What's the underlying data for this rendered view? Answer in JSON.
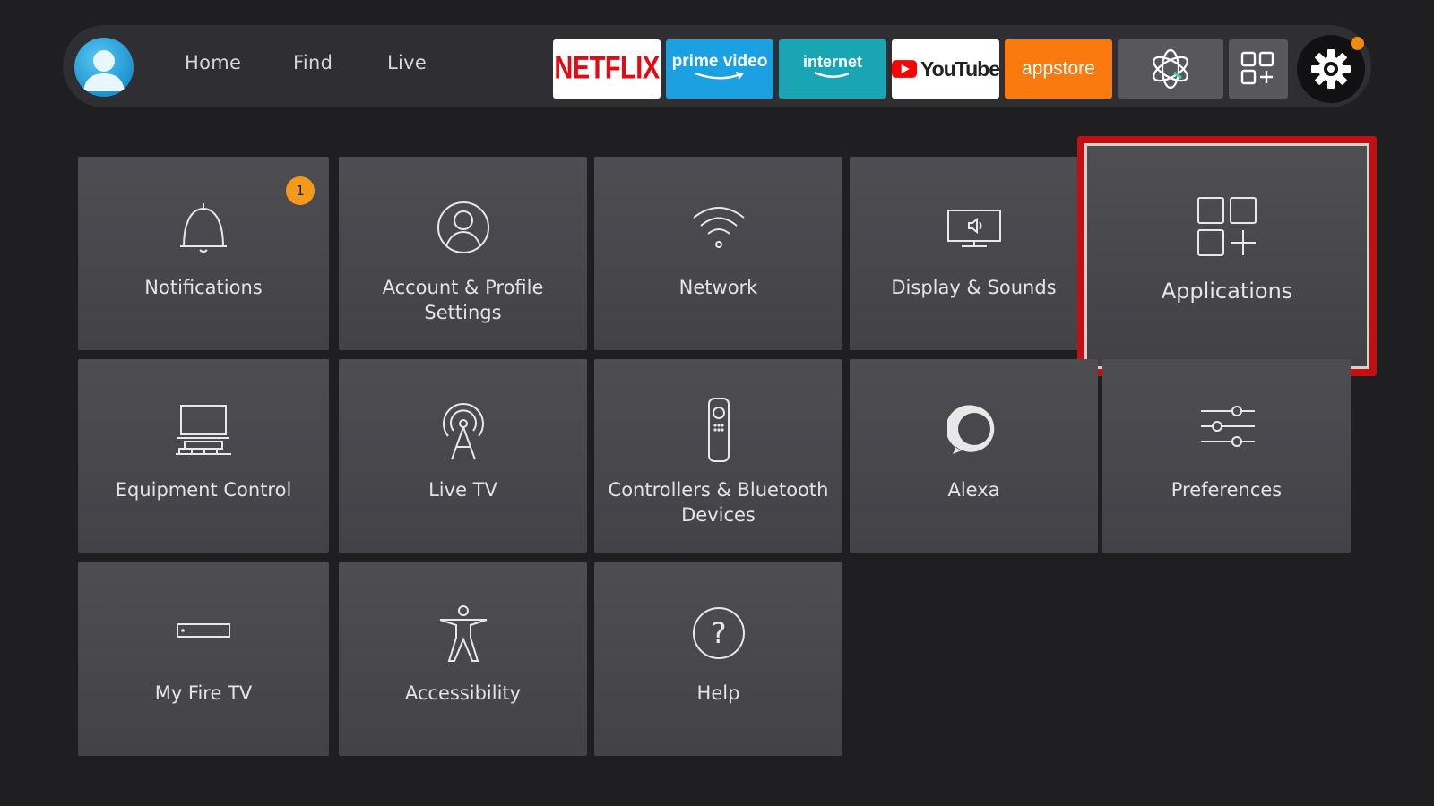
{
  "nav": {
    "links": [
      "Home",
      "Find",
      "Live"
    ],
    "apps": {
      "netflix": "NETFLIX",
      "prime": "prime video",
      "internet": "internet",
      "youtube": "YouTube",
      "appstore": "appstore"
    }
  },
  "tiles": [
    {
      "label": "Notifications",
      "badge": "1"
    },
    {
      "label": "Account & Profile Settings"
    },
    {
      "label": "Network"
    },
    {
      "label": "Display & Sounds"
    },
    {
      "label": "Applications",
      "focused": true
    },
    {
      "label": "Equipment Control"
    },
    {
      "label": "Live TV"
    },
    {
      "label": "Controllers & Bluetooth Devices"
    },
    {
      "label": "Alexa"
    },
    {
      "label": "Preferences"
    },
    {
      "label": "My Fire TV"
    },
    {
      "label": "Accessibility"
    },
    {
      "label": "Help"
    }
  ],
  "colors": {
    "background": "#1f1e21",
    "focus_border": "#c10f14",
    "badge": "#f39a1a",
    "notification_dot": "#f08a10"
  }
}
